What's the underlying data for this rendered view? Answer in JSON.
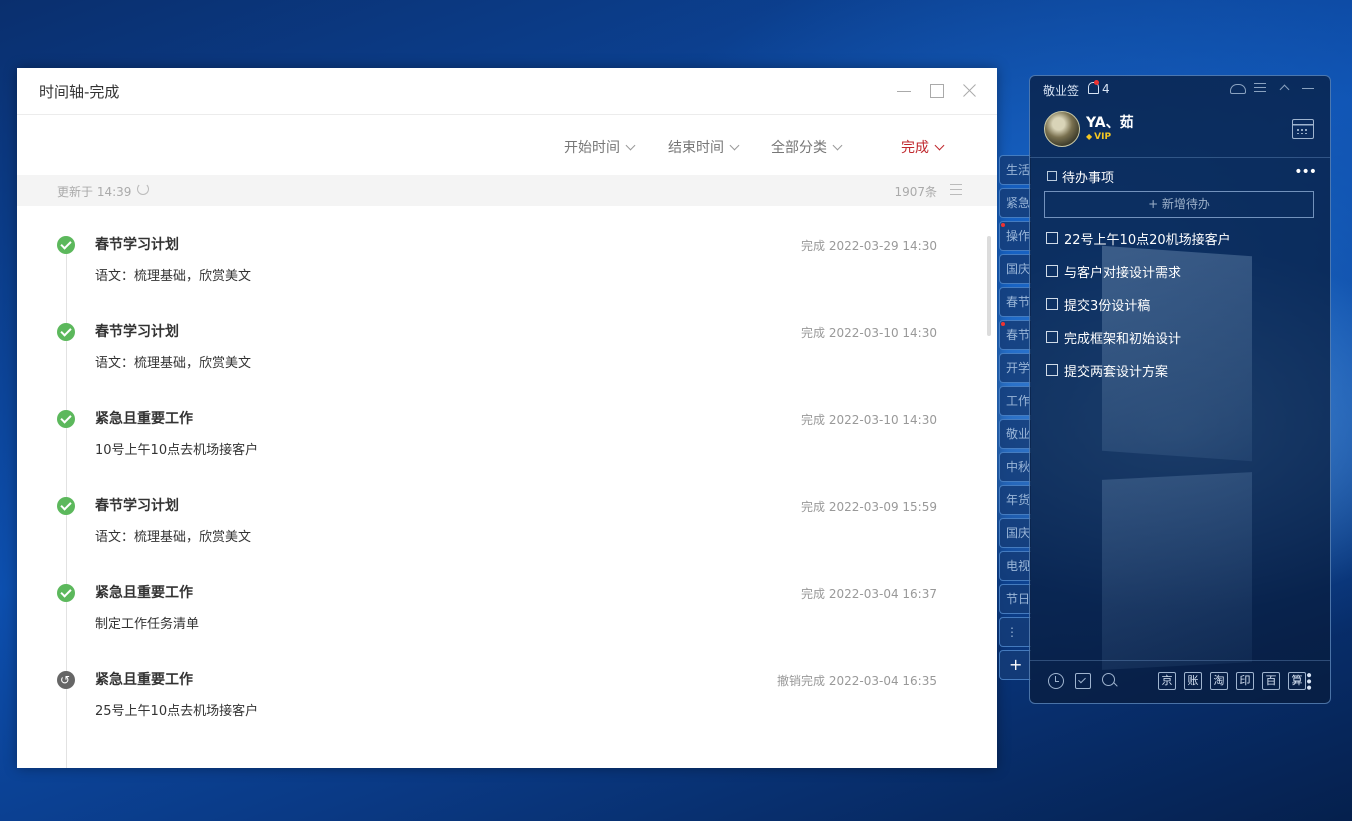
{
  "window": {
    "title": "时间轴-完成",
    "filters": [
      {
        "label": "开始时间",
        "active": false
      },
      {
        "label": "结束时间",
        "active": false
      },
      {
        "label": "全部分类",
        "active": false
      },
      {
        "label": "完成",
        "active": true
      }
    ],
    "status": {
      "updated": "更新于 14:39",
      "count": "1907条"
    },
    "items": [
      {
        "title": "春节学习计划",
        "desc": "语文：梳理基础，欣赏美文",
        "status": "完成 2022-03-29 14:30",
        "state": "done"
      },
      {
        "title": "春节学习计划",
        "desc": "语文：梳理基础，欣赏美文",
        "status": "完成 2022-03-10 14:30",
        "state": "done"
      },
      {
        "title": "紧急且重要工作",
        "desc": "10号上午10点去机场接客户",
        "status": "完成 2022-03-10 14:30",
        "state": "done"
      },
      {
        "title": "春节学习计划",
        "desc": "语文：梳理基础，欣赏美文",
        "status": "完成 2022-03-09 15:59",
        "state": "done"
      },
      {
        "title": "紧急且重要工作",
        "desc": "制定工作任务清单",
        "status": "完成 2022-03-04 16:37",
        "state": "done"
      },
      {
        "title": "紧急且重要工作",
        "desc": "25号上午10点去机场接客户",
        "status": "撤销完成 2022-03-04 16:35",
        "state": "undo"
      }
    ]
  },
  "tabs": [
    "生活",
    "紧急",
    "操作",
    "国庆",
    "春节",
    "春节",
    "开学",
    "工作",
    "敬业",
    "中秋",
    "年货",
    "国庆",
    "电视",
    "节日",
    "⋮",
    "+"
  ],
  "widget": {
    "app_name": "敬业签",
    "notif_count": "4",
    "username": "YA、茹",
    "vip": "VIP",
    "todo_title": "待办事项",
    "more": "•••",
    "add_label": "+ 新增待办",
    "todos": [
      "22号上午10点20机场接客户",
      "与客户对接设计需求",
      "提交3份设计稿",
      "完成框架和初始设计",
      "提交两套设计方案"
    ],
    "footer_links": [
      "京",
      "账",
      "淘",
      "印",
      "百",
      "算"
    ],
    "footer_more": "•••"
  },
  "colors": {
    "accent_red": "#c0272d",
    "done_green": "#5cb85c",
    "undo_gray": "#666666"
  }
}
